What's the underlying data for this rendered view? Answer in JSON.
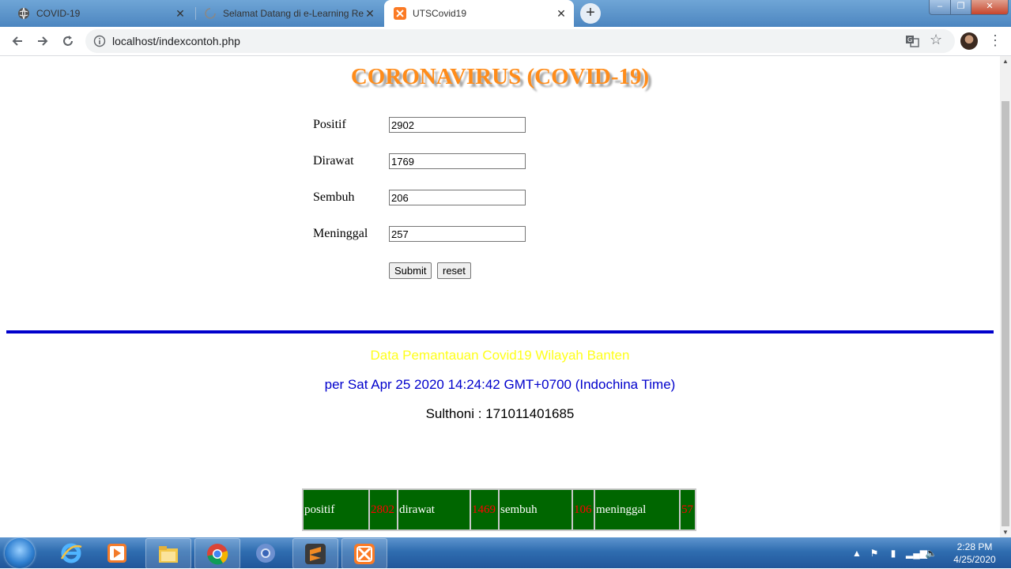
{
  "browser": {
    "tabs": [
      {
        "title": "COVID-19",
        "favicon": "globe-icon",
        "active": false
      },
      {
        "title": "Selamat Datang di e-Learning Re",
        "favicon": "loading-spinner-icon",
        "active": false
      },
      {
        "title": "UTSCovid19",
        "favicon": "xampp-icon",
        "active": true
      }
    ],
    "url": "localhost/indexcontoh.php"
  },
  "page": {
    "title": "CORONAVIRUS (COVID-19)",
    "form": {
      "fields": [
        {
          "label": "Positif",
          "value": "2902"
        },
        {
          "label": "Dirawat",
          "value": "1769"
        },
        {
          "label": "Sembuh",
          "value": "206"
        },
        {
          "label": "Meninggal",
          "value": "257"
        }
      ],
      "submit_label": "Submit",
      "reset_label": "reset"
    },
    "info": {
      "title": "Data Pemantauan Covid19 Wilayah Banten",
      "date": "per Sat Apr 25 2020 14:24:42 GMT+0700 (Indochina Time)",
      "author": "Sulthoni : 171011401685"
    },
    "table": {
      "cells": [
        {
          "label": "positif",
          "value": "2802"
        },
        {
          "label": "dirawat",
          "value": "1469"
        },
        {
          "label": "sembuh",
          "value": "106"
        },
        {
          "label": "meninggal",
          "value": "57"
        }
      ]
    }
  },
  "taskbar": {
    "clock_time": "2:28 PM",
    "clock_date": "4/25/2020",
    "apps": [
      "internet-explorer-icon",
      "media-player-icon",
      "file-explorer-icon",
      "chrome-icon",
      "chrome-canary-icon",
      "sublime-text-icon",
      "xampp-icon"
    ]
  },
  "colors": {
    "title_orange": "#ff8c1a",
    "divider_blue": "#0000cc",
    "info_yellow": "#ffff1a",
    "table_green": "#006600",
    "table_value_red": "#ff0000"
  }
}
